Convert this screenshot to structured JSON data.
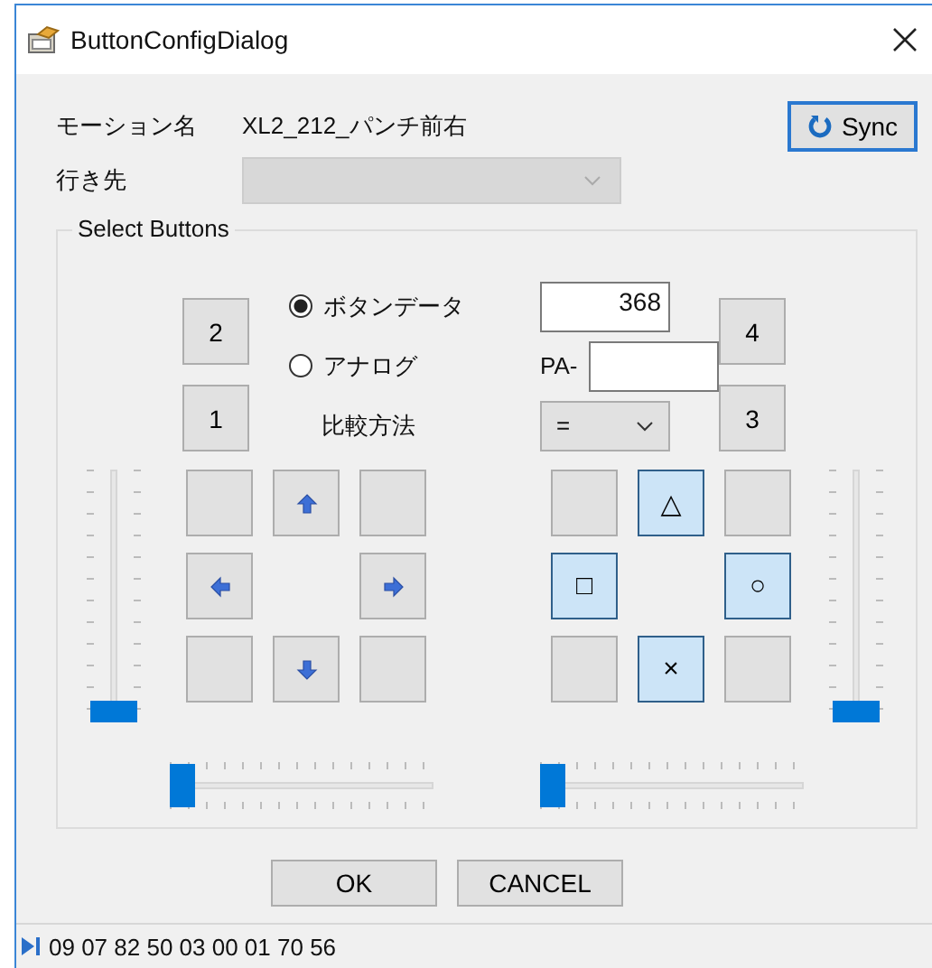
{
  "window": {
    "title": "ButtonConfigDialog"
  },
  "motion": {
    "label": "モーション名",
    "value": "XL2_212_パンチ前右"
  },
  "sync_button": {
    "label": "Sync"
  },
  "destination": {
    "label": "行き先",
    "disabled": true
  },
  "select_buttons": {
    "title": "Select Buttons",
    "left_shoulder": [
      {
        "label": "2",
        "selected": false
      },
      {
        "label": "1",
        "selected": false
      }
    ],
    "radios": [
      {
        "label": "ボタンデータ",
        "selected": true
      },
      {
        "label": "アナログ",
        "selected": false
      }
    ],
    "button_data_value": "368",
    "analog_prefix": "PA-",
    "compare": {
      "label": "比較方法",
      "value": "="
    },
    "right_shoulder": [
      {
        "label": "4",
        "selected": false
      },
      {
        "label": "3",
        "selected": false
      }
    ],
    "dpad": [
      {
        "kind": "blank",
        "selected": false
      },
      {
        "kind": "up",
        "selected": false
      },
      {
        "kind": "blank",
        "selected": false
      },
      {
        "kind": "left",
        "selected": false
      },
      {
        "kind": "right",
        "selected": false
      },
      {
        "kind": "blank",
        "selected": false
      },
      {
        "kind": "down",
        "selected": false
      },
      {
        "kind": "blank",
        "selected": false
      }
    ],
    "face": [
      {
        "kind": "blank",
        "selected": false
      },
      {
        "kind": "symbol",
        "label": "△",
        "selected": true
      },
      {
        "kind": "blank",
        "selected": false
      },
      {
        "kind": "symbol",
        "label": "□",
        "selected": true
      },
      {
        "kind": "symbol",
        "label": "○",
        "selected": true
      },
      {
        "kind": "blank",
        "selected": false
      },
      {
        "kind": "symbol",
        "label": "×",
        "selected": true
      },
      {
        "kind": "blank",
        "selected": false
      }
    ],
    "left_vertical_slider": {
      "level": 0
    },
    "right_vertical_slider": {
      "level": 0
    },
    "left_horizontal_slider": {
      "level": 0
    },
    "right_horizontal_slider": {
      "level": 0
    }
  },
  "buttons": [
    "OK",
    "CANCEL"
  ],
  "status_bar": {
    "text": "09 07 82 50 03 00 01 70 56"
  }
}
